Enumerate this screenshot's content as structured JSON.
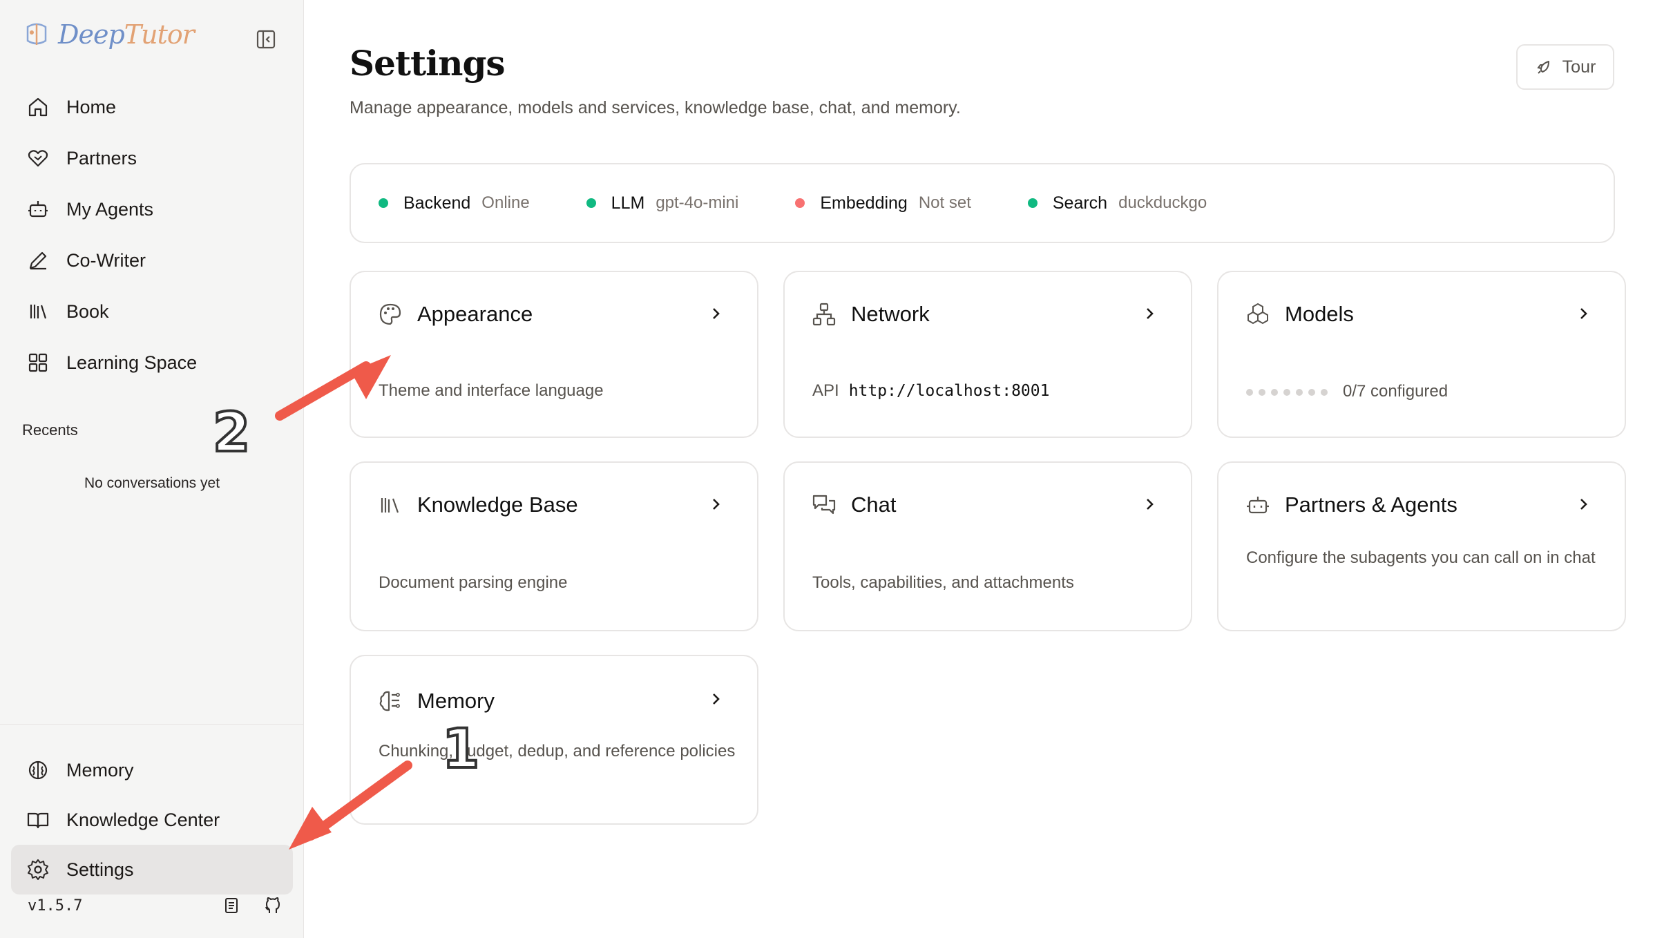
{
  "app": {
    "logo_part1": "Deep",
    "logo_part2": "Tutor"
  },
  "sidebar": {
    "nav": [
      {
        "label": "Home",
        "icon": "home-icon"
      },
      {
        "label": "Partners",
        "icon": "handshake-icon"
      },
      {
        "label": "My Agents",
        "icon": "bot-icon"
      },
      {
        "label": "Co-Writer",
        "icon": "pen-icon"
      },
      {
        "label": "Book",
        "icon": "library-icon"
      },
      {
        "label": "Learning Space",
        "icon": "grid-icon"
      }
    ],
    "recents_label": "Recents",
    "no_conversations": "No conversations yet",
    "bottom": [
      {
        "label": "Memory",
        "icon": "brain-icon"
      },
      {
        "label": "Knowledge Center",
        "icon": "book-open-icon"
      },
      {
        "label": "Settings",
        "icon": "gear-icon",
        "active": true
      }
    ],
    "version": "v1.5.7"
  },
  "header": {
    "title": "Settings",
    "subtitle": "Manage appearance, models and services, knowledge base, chat, and memory.",
    "tour_label": "Tour"
  },
  "status": [
    {
      "name": "Backend",
      "value": "Online",
      "color": "#10b981"
    },
    {
      "name": "LLM",
      "value": "gpt-4o-mini",
      "color": "#10b981"
    },
    {
      "name": "Embedding",
      "value": "Not set",
      "color": "#f87171"
    },
    {
      "name": "Search",
      "value": "duckduckgo",
      "color": "#10b981"
    }
  ],
  "cards": {
    "appearance": {
      "title": "Appearance",
      "desc": "Theme and interface language"
    },
    "network": {
      "title": "Network",
      "api_label": "API",
      "api_value": "http://localhost:8001"
    },
    "models": {
      "title": "Models",
      "configured": "0/7 configured"
    },
    "knowledge": {
      "title": "Knowledge Base",
      "desc": "Document parsing engine"
    },
    "chat": {
      "title": "Chat",
      "desc": "Tools, capabilities, and attachments"
    },
    "partners": {
      "title": "Partners & Agents",
      "desc": "Configure the subagents you can call on in chat"
    },
    "memory": {
      "title": "Memory",
      "desc": "Chunking, budget, dedup, and reference policies"
    }
  },
  "annotations": {
    "one": "1",
    "two": "2"
  },
  "colors": {
    "arrow": "#ef5a4a",
    "online": "#10b981",
    "offline": "#f87171"
  }
}
